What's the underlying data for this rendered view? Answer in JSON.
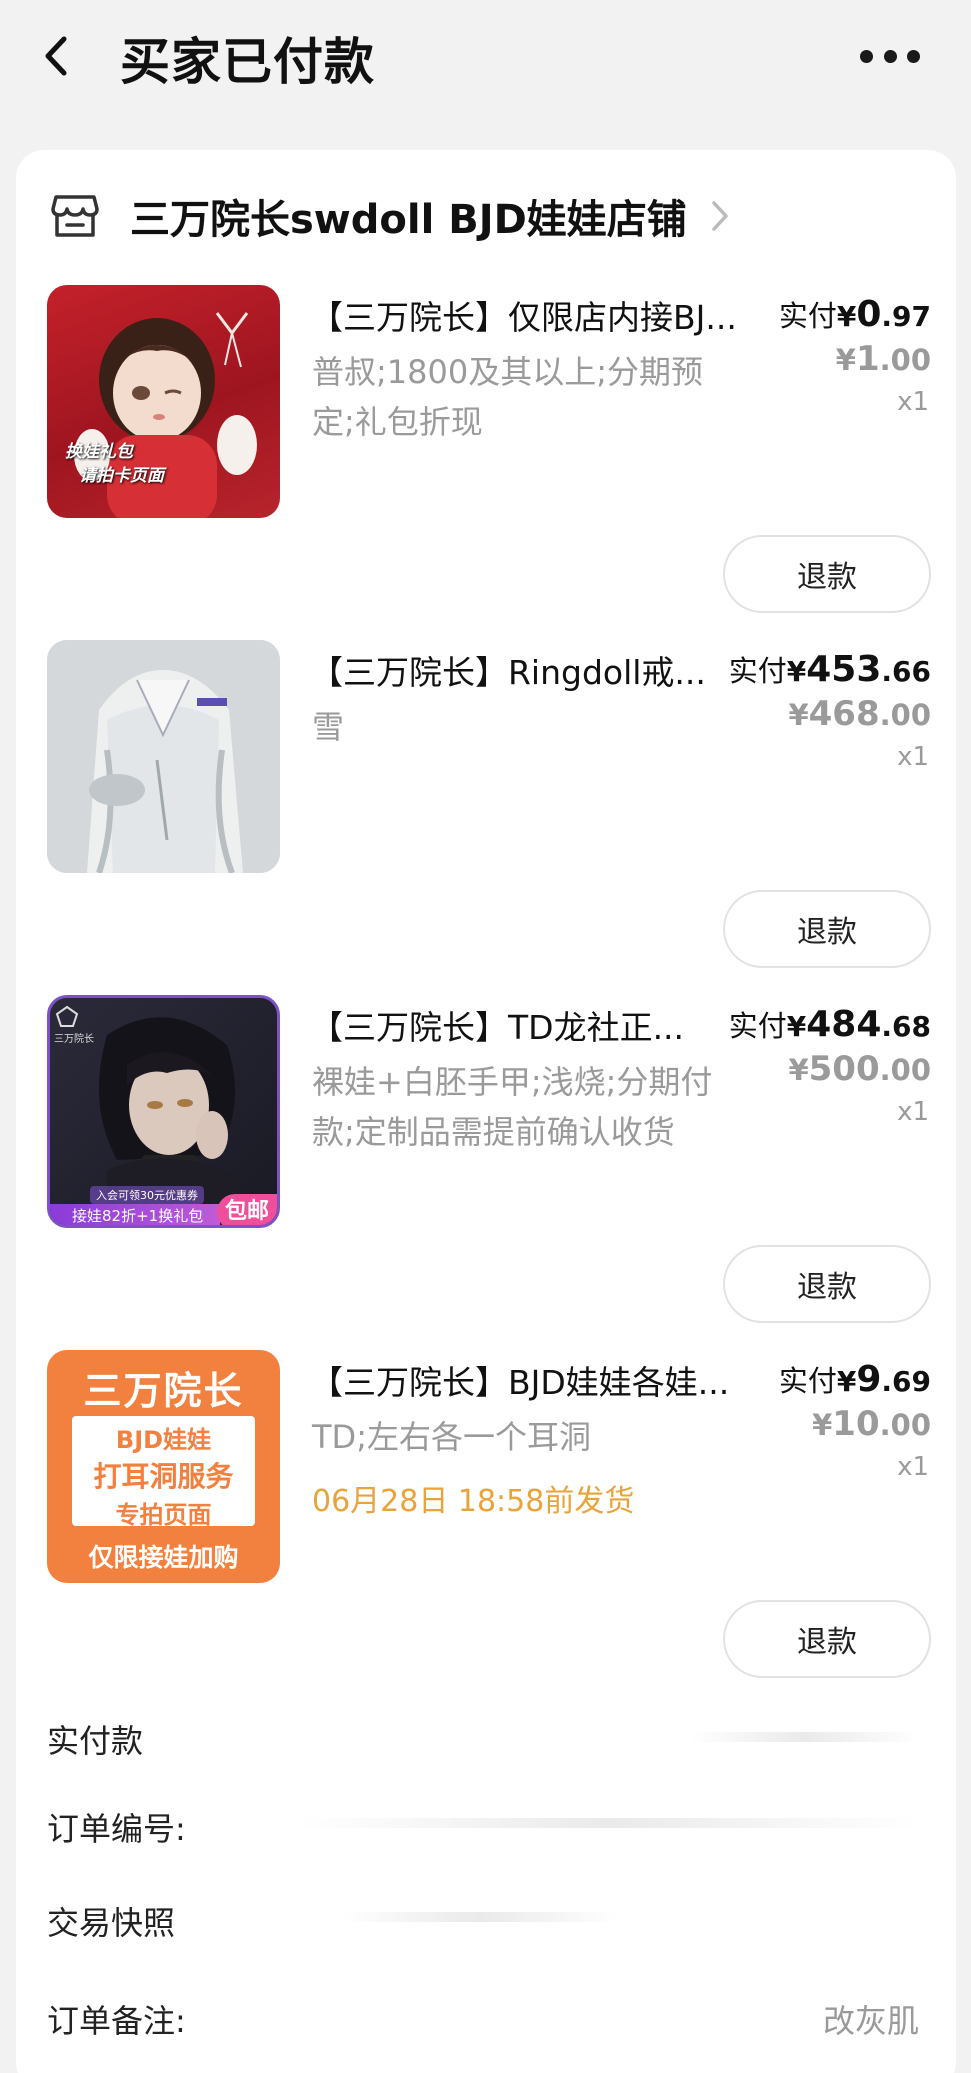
{
  "header": {
    "title": "买家已付款",
    "back_icon": "chevron-left-icon",
    "more_icon": "more-dots-icon"
  },
  "shop": {
    "name": "三万院长swdoll BJD娃娃店铺",
    "icon": "store-icon"
  },
  "items": [
    {
      "title": "【三万院长】仅限店内接BJ...",
      "spec": "普叔;1800及其以上;分期预定;礼包折现",
      "paid_label": "实付",
      "paid_int": "0",
      "paid_dec": ".97",
      "orig_int": "1",
      "orig_dec": ".00",
      "qty": "x1",
      "thumb_text_1": "换娃礼包",
      "thumb_text_2": "请拍卡页面",
      "refund": "退款"
    },
    {
      "title": "【三万院长】Ringdoll戒...",
      "spec": "雪",
      "paid_label": "实付",
      "paid_int": "453",
      "paid_dec": ".66",
      "orig_int": "468",
      "orig_dec": ".00",
      "qty": "x1",
      "refund": "退款"
    },
    {
      "title": "【三万院长】TD龙社正...",
      "spec": "裸娃+白胚手甲;浅烧;分期付款;定制品需提前确认收货",
      "paid_label": "实付",
      "paid_int": "484",
      "paid_dec": ".68",
      "orig_int": "500",
      "orig_dec": ".00",
      "qty": "x1",
      "thumb_logo": "三万院长",
      "thumb_small": "入会可领30元优惠券",
      "thumb_banner": "接娃82折+1换礼包",
      "thumb_badge": "包邮",
      "refund": "退款"
    },
    {
      "title": "【三万院长】BJD娃娃各娃...",
      "spec": "TD;左右各一个耳洞",
      "ship": "06月28日 18:58前发货",
      "paid_label": "实付",
      "paid_int": "9",
      "paid_dec": ".69",
      "orig_int": "10",
      "orig_dec": ".00",
      "qty": "x1",
      "thumb_top": "三万院长",
      "thumb_l1": "BJD娃娃",
      "thumb_l2": "打耳洞服务",
      "thumb_l3": "专拍页面",
      "thumb_bottom": "仅限接娃加购",
      "refund": "退款"
    }
  ],
  "info": {
    "paid_label": "实付款",
    "order_no_label": "订单编号:",
    "snapshot_label": "交易快照",
    "note_label": "订单备注:",
    "note_value": "改灰肌"
  },
  "colors": {
    "accent_orange": "#f0803c",
    "ship_text": "#e8a33a",
    "muted": "#9a9a9a"
  }
}
